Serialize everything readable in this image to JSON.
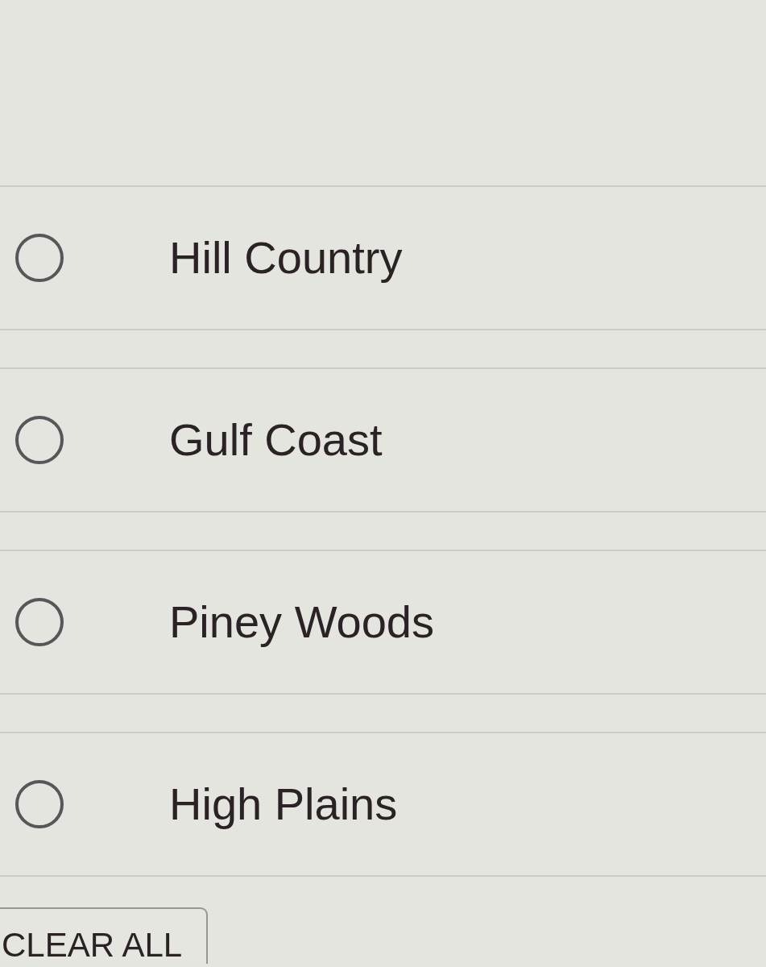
{
  "options": [
    {
      "label": "Hill Country",
      "selected": false
    },
    {
      "label": "Gulf Coast",
      "selected": false
    },
    {
      "label": "Piney Woods",
      "selected": false
    },
    {
      "label": "High Plains",
      "selected": false
    }
  ],
  "clear_button": {
    "label": "CLEAR ALL"
  }
}
